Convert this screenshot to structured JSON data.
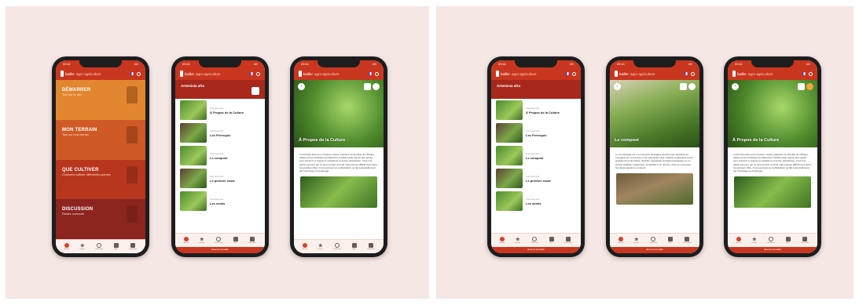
{
  "status": {
    "time": "09:41",
    "signal": "4G"
  },
  "app": {
    "brand": "bailler",
    "brand_sub": "agro-agriculture"
  },
  "tabs": [
    "Accueil",
    "Favoris",
    "Recherche",
    "Aide",
    "Paramètres"
  ],
  "footer": "découvrir par bailler",
  "home": {
    "bands": [
      {
        "title": "DÉMARRER",
        "subtitle": "Tout sur le site",
        "color": "#e2872f"
      },
      {
        "title": "MON TERRAIN",
        "subtitle": "Tout sur mon terrain",
        "color": "#cf5a26"
      },
      {
        "title": "QUE CULTIVER",
        "subtitle": "Comment cultiver différentes plantes",
        "color": "#b8361e"
      },
      {
        "title": "DISCUSSION",
        "subtitle": "Restez connecté",
        "color": "#8c2420"
      }
    ]
  },
  "list": {
    "title": "Artemisia afra",
    "items": [
      {
        "meta": "Artemisia afra",
        "title": "À Propos de la Culture"
      },
      {
        "meta": "Artemisia afra",
        "title": "Les Prérequis"
      },
      {
        "meta": "Artemisia afra",
        "title": "Le compost"
      },
      {
        "meta": "Artemisia afra",
        "title": "Le premier essai"
      },
      {
        "meta": "Artemisia afra",
        "title": "Les semis"
      }
    ]
  },
  "detail_about": {
    "back": "‹",
    "title": "À Propos de la Culture",
    "text": "L'Artemisia afra est un buisson vivace originaire du Sud-Est de l'Afrique, utilisé par les Praticiens de Médecine Traditionnelle depuis des siècles pour prévenir et soigner le paludisme et autres parasitoses. C'est une plante pérenne qui ne peut résister au froid mais pousse difficilement dans les grandes villes. C'est pourquoi sa multiplication se fait essentiellement par bouturage ou bouturage."
  },
  "detail_compost": {
    "back": "‹",
    "title": "Le compost",
    "text": "Le compostage est un processus biologique aérobie (qui nécessite de l'oxygène) de conversion et de valorisation des matières organiques (sous-produits de la biomasse, déchets organiques d'origine biologique) en un produit stabilisé, hygiénique, semblable à un terreau, riche en composés humiques appelé le compost."
  }
}
